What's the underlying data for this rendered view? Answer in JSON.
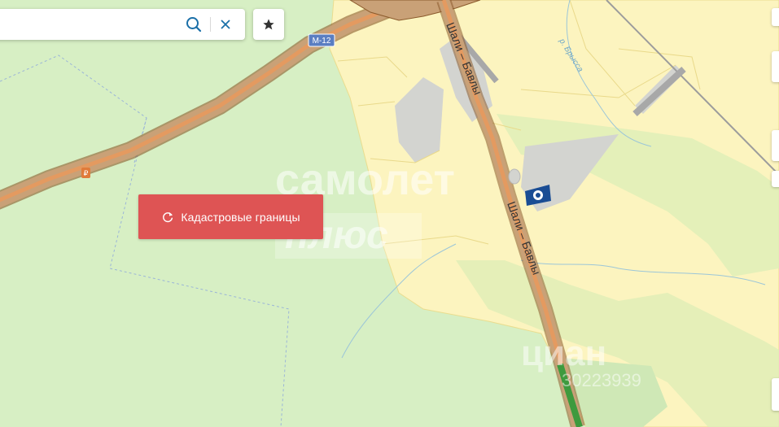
{
  "search": {
    "value": "",
    "placeholder": ""
  },
  "buttons": {
    "cadastral_label": "Кадастровые границы"
  },
  "map": {
    "highway_shield": "М-12",
    "road_label_north": "Шали – Бавлы",
    "road_label_south": "Шали – Бавлы",
    "river_label": "р. Брысса",
    "poi_fuel_marker": "₽"
  },
  "watermarks": {
    "top_line": "самолет",
    "bottom_line": "плюс",
    "cian_brand": "циан",
    "cian_id": "30223939"
  },
  "icons": {
    "search": "search-icon",
    "clear": "close-icon",
    "favorite": "star-icon",
    "refresh": "refresh-icon",
    "gas_station": "gas-station-icon"
  },
  "colors": {
    "forest": "#d7efc4",
    "settlement": "#fcf4bf",
    "road_fill": "#e49a60",
    "road_edge": "#8b5a2b",
    "industrial": "#d3d4d0",
    "button_red": "#de5454",
    "poi_blue": "#1a4d94"
  }
}
